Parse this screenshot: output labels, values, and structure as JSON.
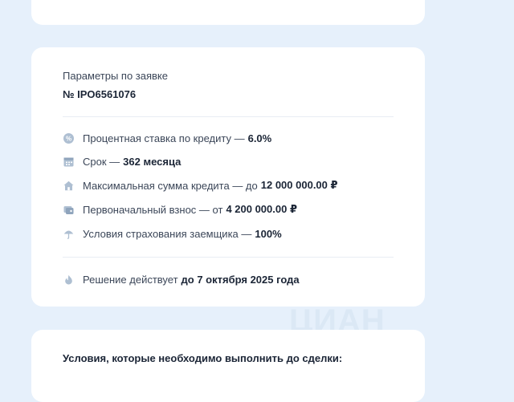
{
  "params": {
    "label": "Параметры по заявке",
    "number": "№ IPO6561076",
    "rows": [
      {
        "icon": "percent-icon",
        "label": "Процентная ставка по кредиту —",
        "value": "6.0%"
      },
      {
        "icon": "calendar-icon",
        "label": "Срок —",
        "value": "362 месяца"
      },
      {
        "icon": "house-icon",
        "label": "Максимальная сумма кредита — до",
        "value": "12 000 000.00 ₽"
      },
      {
        "icon": "wallet-icon",
        "label": "Первоначальный взнос — от",
        "value": "4 200 000.00 ₽"
      },
      {
        "icon": "umbrella-icon",
        "label": "Условия страхования заемщика —",
        "value": "100%"
      }
    ],
    "decision": {
      "icon": "fire-icon",
      "label": "Решение действует",
      "value": "до 7 октября 2025 года"
    }
  },
  "conditions": {
    "title": "Условия, которые необходимо выполнить до сделки:"
  },
  "watermark": "ЦИАН",
  "colors": {
    "background": "#e6f0fb",
    "card": "#ffffff",
    "icon": "#aebfd2"
  }
}
